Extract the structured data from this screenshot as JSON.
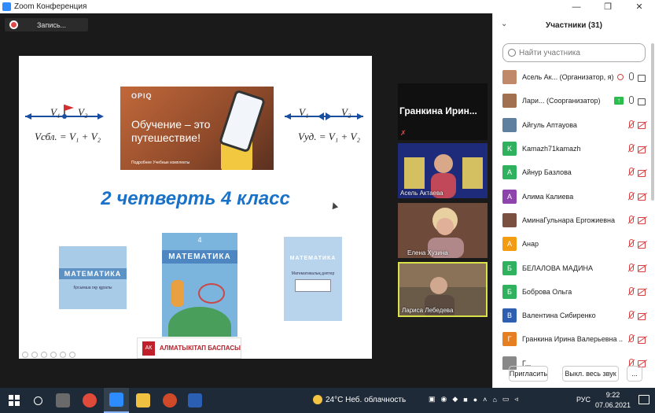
{
  "window": {
    "title": "Zoom Конференция",
    "btn_minimize": "—",
    "btn_restore": "❐",
    "btn_close": "✕"
  },
  "recording": {
    "label": "Запись..."
  },
  "slide": {
    "formula_left_v1": "V₁",
    "formula_left_v2": "V₂",
    "formula_left_eq": "Vсбл. = V₁ + V₂",
    "formula_right_v1": "V₁",
    "formula_right_v2": "V₂",
    "formula_right_eq": "Vуд. = V₁ + V₂",
    "banner_logo": "OPIQ",
    "banner_slogan": "Обучение – это путешествие!",
    "banner_badges": "Подробнее   Учебные комплекты",
    "headline": "2 четверть 4 класс",
    "book1_title": "МАТЕМАТИКА",
    "book1_sub": "Қосымша оқу құралы",
    "book2_num": "4",
    "book2_title": "МАТЕМАТИКА",
    "book3_title": "МАТЕМАТИКА",
    "book3_sub": "Математикалық дәптер",
    "publisher": "АЛМАТЫКІТАП БАСПАСЫ",
    "publisher_logo": "АК"
  },
  "videos": [
    {
      "name": "Гранкина  Ирин...",
      "muted": true
    },
    {
      "name": "Асель Актаева"
    },
    {
      "name": "Елена Хузина",
      "muted": true
    },
    {
      "name": "Лариса Лебедева"
    }
  ],
  "panel": {
    "title": "Участники (31)",
    "search_placeholder": "Найти участника",
    "invite_label": "Пригласить",
    "mute_all_label": "Выкл. весь звук",
    "more_label": "...",
    "participants": [
      {
        "name": "Асель Ак...  (Организатор, я)",
        "avatar": "",
        "color": "#c08a6a",
        "mic": "gray",
        "cam": "gray",
        "recording": true
      },
      {
        "name": "Лари...  (Соорганизатор)",
        "avatar": "",
        "color": "#a07050",
        "mic": "gray",
        "cam": "gray",
        "share": true
      },
      {
        "name": "Айгуль Аптауова",
        "avatar": "",
        "color": "#6080a0",
        "mic": "red",
        "cam": "red"
      },
      {
        "name": "Kamazh71kamazh",
        "avatar": "K",
        "color": "#2fb15e",
        "mic": "red",
        "cam": "red"
      },
      {
        "name": "Айнур Базлова",
        "avatar": "А",
        "color": "#2fb15e",
        "mic": "red",
        "cam": "red"
      },
      {
        "name": "Алима Калиева",
        "avatar": "А",
        "color": "#8e44ad",
        "mic": "red",
        "cam": "red"
      },
      {
        "name": "АминаГульнара Ергожиевна",
        "avatar": "",
        "color": "#7a5040",
        "mic": "red",
        "cam": "red"
      },
      {
        "name": "Анар",
        "avatar": "А",
        "color": "#f39c12",
        "mic": "red",
        "cam": "red"
      },
      {
        "name": "БЕЛАЛОВА МАДИНА",
        "avatar": "Б",
        "color": "#2fb15e",
        "mic": "red",
        "cam": "red"
      },
      {
        "name": "Боброва Ольга",
        "avatar": "Б",
        "color": "#2fb15e",
        "mic": "red",
        "cam": "red"
      },
      {
        "name": "Валентина Сибиренко",
        "avatar": "В",
        "color": "#2f5fb1",
        "mic": "red",
        "cam": "red"
      },
      {
        "name": "Гранкина Ирина Валерьевна ...",
        "avatar": "Г",
        "color": "#e67e22",
        "mic": "red",
        "cam": "red"
      },
      {
        "name": "Г...",
        "avatar": "",
        "color": "#888",
        "mic": "red",
        "cam": "red"
      }
    ]
  },
  "taskbar": {
    "weather": "24°C  Неб. облачность",
    "lang": "РУС",
    "time": "9:22",
    "date": "07.06.2021"
  }
}
